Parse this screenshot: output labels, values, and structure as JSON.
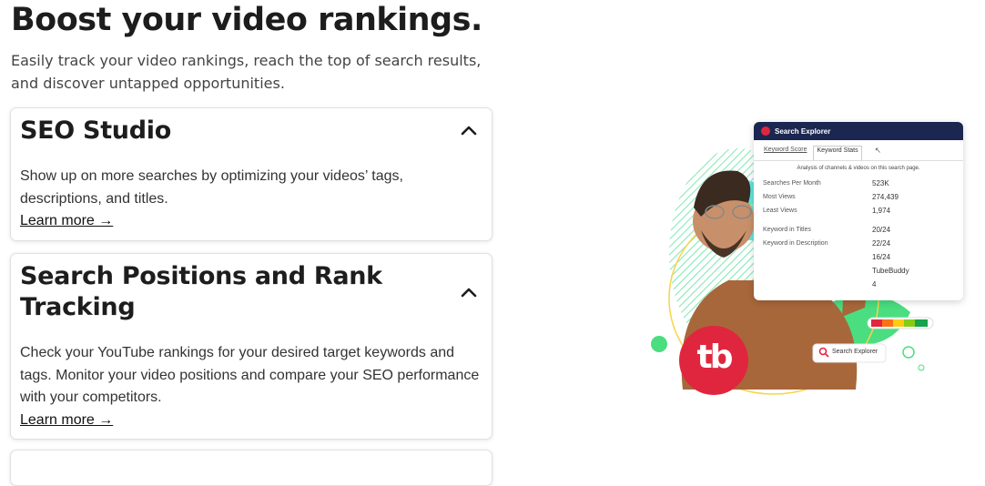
{
  "hero": {
    "title": "Boost your video rankings.",
    "subtitle": "Easily track your video rankings, reach the top of search results, and discover untapped opportunities."
  },
  "cards": [
    {
      "title": "SEO Studio",
      "description": "Show up on more searches by optimizing your videos’ tags, descriptions, and titles.",
      "link": "Learn more →",
      "expanded": true
    },
    {
      "title": "Search Positions and Rank Tracking",
      "description": "Check your YouTube rankings for your desired target keywords and tags. Monitor your video positions and compare your SEO performance with your competitors.",
      "link": "Learn more →",
      "expanded": true
    }
  ],
  "explorer": {
    "title": "Search Explorer",
    "tabs": [
      "Keyword Score",
      "Keyword Stats"
    ],
    "active_tab": "Keyword Stats",
    "note": "Analysis of channels & videos on this search page.",
    "rows_a": [
      {
        "label": "Searches Per Month",
        "value": "523K"
      },
      {
        "label": "Most Views",
        "value": "274,439"
      },
      {
        "label": "Least Views",
        "value": "1,974"
      }
    ],
    "rows_b": [
      {
        "label": "Keyword in Titles",
        "value": "20/24"
      },
      {
        "label": "Keyword in Description",
        "value": "22/24"
      },
      {
        "label": "",
        "value": "16/24"
      },
      {
        "label": "",
        "value": "TubeBuddy"
      },
      {
        "label": "",
        "value": "4"
      }
    ],
    "search_pill": "Search Explorer",
    "brand_mark": "tb"
  },
  "colors": {
    "brand_red": "#e0263f",
    "panel_header": "#1b2750",
    "accent_green": "#4ade80",
    "accent_cyan": "#5ee6e0"
  }
}
